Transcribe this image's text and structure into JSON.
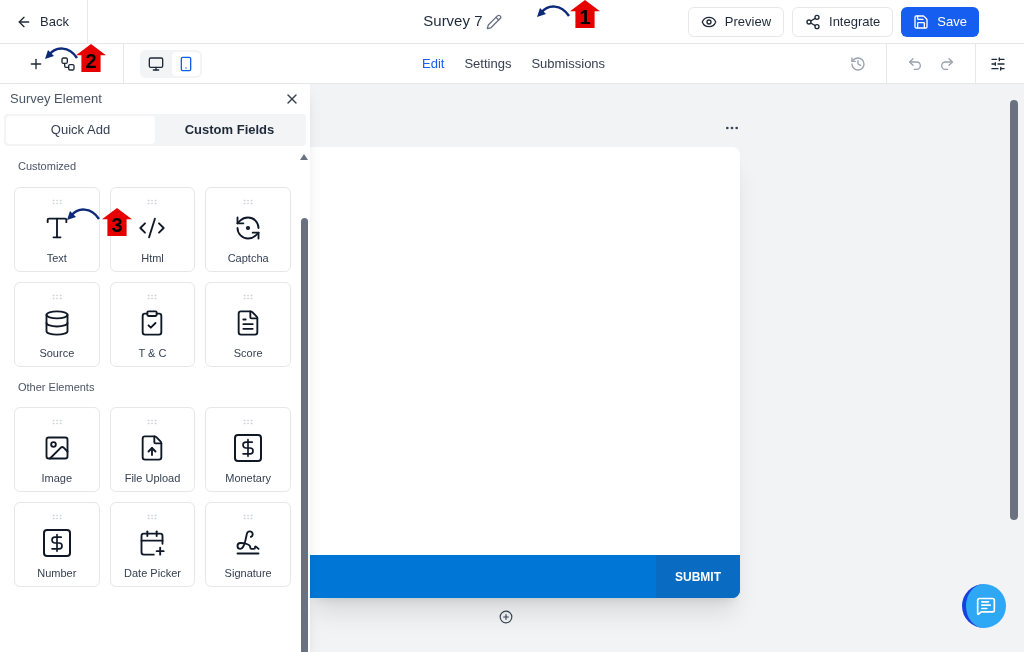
{
  "header": {
    "back": "Back",
    "title": "Survey 7",
    "buttons": [
      {
        "label": "Preview",
        "kind": "outline"
      },
      {
        "label": "Integrate",
        "kind": "outline"
      },
      {
        "label": "Save",
        "kind": "primary"
      }
    ]
  },
  "toolbar": {
    "devices": [
      {
        "kind": "desktop",
        "selected": false
      },
      {
        "kind": "mobile",
        "selected": true
      }
    ],
    "tabs": [
      {
        "label": "Edit",
        "selected": true
      },
      {
        "label": "Settings",
        "selected": false
      },
      {
        "label": "Submissions",
        "selected": false
      }
    ]
  },
  "panel": {
    "title": "Survey Element",
    "tabs": [
      {
        "label": "Quick Add",
        "selected": true
      },
      {
        "label": "Custom Fields",
        "selected": false
      }
    ],
    "sections": [
      {
        "title": "Customized",
        "items": [
          {
            "label": "Text",
            "kind": "text"
          },
          {
            "label": "Html",
            "kind": "html"
          },
          {
            "label": "Captcha",
            "kind": "captcha"
          },
          {
            "label": "Source",
            "kind": "source"
          },
          {
            "label": "T & C",
            "kind": "terms"
          },
          {
            "label": "Score",
            "kind": "score"
          }
        ]
      },
      {
        "title": "Other Elements",
        "items": [
          {
            "label": "Image",
            "kind": "image"
          },
          {
            "label": "File Upload",
            "kind": "upload"
          },
          {
            "label": "Monetary",
            "kind": "money"
          },
          {
            "label": "Number",
            "kind": "money"
          },
          {
            "label": "Date Picker",
            "kind": "date"
          },
          {
            "label": "Signature",
            "kind": "signature"
          }
        ]
      }
    ]
  },
  "canvas": {
    "submit": "SUBMIT"
  },
  "annotations": [
    {
      "label": "1"
    },
    {
      "label": "2"
    },
    {
      "label": "3"
    }
  ]
}
